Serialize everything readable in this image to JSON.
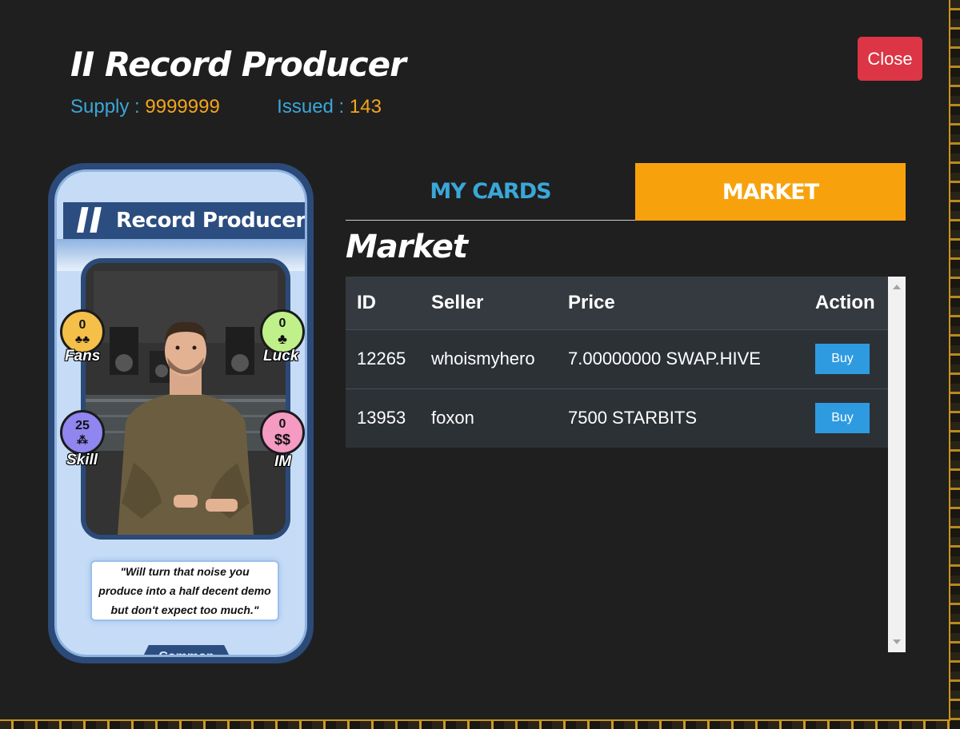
{
  "header": {
    "title": "II Record Producer",
    "supply_label": "Supply : ",
    "supply_value": "9999999",
    "issued_label": "Issued : ",
    "issued_value": "143",
    "close_label": "Close"
  },
  "card": {
    "tier": "II",
    "name": "Record Producer",
    "stats": {
      "fans": {
        "label": "Fans",
        "value": "0"
      },
      "luck": {
        "label": "Luck",
        "value": "0"
      },
      "skill": {
        "label": "Skill",
        "value": "25"
      },
      "im": {
        "label": "IM",
        "value": "0"
      }
    },
    "quote": "\"Will turn that noise you produce into a half decent demo but don't expect too much.\"",
    "rarity": "Common"
  },
  "tabs": {
    "my_cards": "MY CARDS",
    "market": "MARKET"
  },
  "market": {
    "title": "Market",
    "columns": {
      "id": "ID",
      "seller": "Seller",
      "price": "Price",
      "action": "Action"
    },
    "rows": [
      {
        "id": "12265",
        "seller": "whoismyhero",
        "price": "7.00000000 SWAP.HIVE",
        "action": "Buy"
      },
      {
        "id": "13953",
        "seller": "foxon",
        "price": "7500 STARBITS",
        "action": "Buy"
      }
    ]
  },
  "colors": {
    "accent_blue": "#3aa7d8",
    "accent_orange": "#f4a51c",
    "tab_active": "#f7a20d",
    "close_red": "#dc3545",
    "buy_blue": "#2e9be0",
    "fans_badge": "#f5c04a",
    "luck_badge": "#bff08a",
    "skill_badge": "#8f86f0",
    "im_badge": "#f59ac2"
  }
}
